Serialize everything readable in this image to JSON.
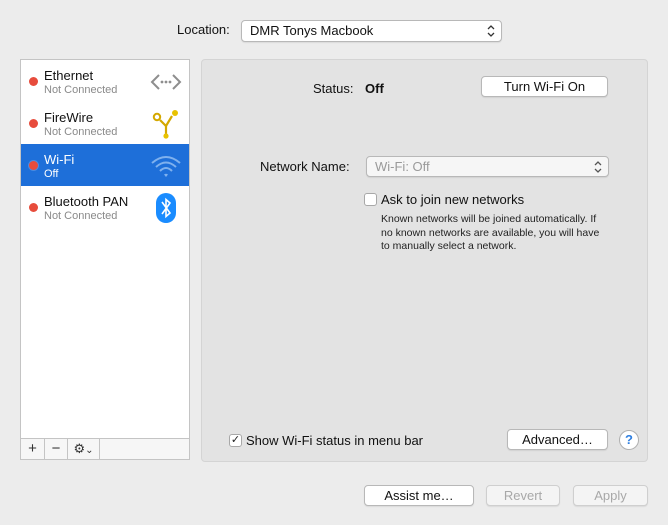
{
  "location": {
    "label": "Location:",
    "value": "DMR Tonys Macbook"
  },
  "services": [
    {
      "name": "Ethernet",
      "status": "Not Connected",
      "status_color": "#e74c3c",
      "icon": "ethernet-arrows-icon"
    },
    {
      "name": "FireWire",
      "status": "Not Connected",
      "status_color": "#e74c3c",
      "icon": "firewire-icon"
    },
    {
      "name": "Wi-Fi",
      "status": "Off",
      "status_color": "#e74c3c",
      "icon": "wifi-icon",
      "selected": true
    },
    {
      "name": "Bluetooth PAN",
      "status": "Not Connected",
      "status_color": "#e74c3c",
      "icon": "bluetooth-icon"
    }
  ],
  "sidebar_toolbar": {
    "add": "+",
    "remove": "−",
    "gear": "⚙",
    "gear_chevron": "⌄"
  },
  "detail": {
    "status_label": "Status:",
    "status_value": "Off",
    "turn_on_button": "Turn Wi-Fi On",
    "network_name_label": "Network Name:",
    "network_name_value": "Wi-Fi: Off",
    "ask_join_label": "Ask to join new networks",
    "ask_join_checked": false,
    "ask_join_help_line1": "Known networks will be joined automatically. If",
    "ask_join_help_line2": "no known networks are available, you will have",
    "ask_join_help_line3": "to manually select a network.",
    "show_status_label": "Show Wi-Fi status in menu bar",
    "show_status_checked": true,
    "show_status_checkmark": "✓",
    "advanced_button": "Advanced…",
    "help_button": "?"
  },
  "footer": {
    "assist_button": "Assist me…",
    "revert_button": "Revert",
    "apply_button": "Apply"
  },
  "colors": {
    "accent": "#1e6fd9",
    "status_red": "#e74c3c",
    "bluetooth": "#1a8cff"
  }
}
